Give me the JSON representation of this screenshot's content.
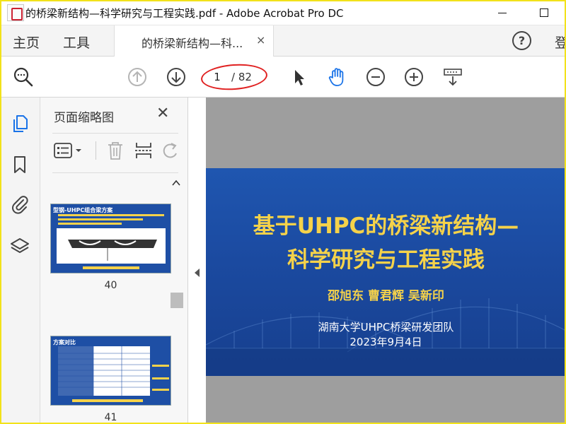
{
  "window": {
    "title": "的桥梁新结构—科学研究与工程实践.pdf - Adobe Acrobat Pro DC"
  },
  "tabs": {
    "home": "主页",
    "tools": "工具",
    "document": "的桥梁新结构—科...",
    "close": "×",
    "help": "?",
    "signin": "登"
  },
  "toolbar": {
    "current_page": "1",
    "total_pages": "/ 82"
  },
  "panel": {
    "title": "页面缩略图",
    "close": "✕",
    "thumbnails": [
      {
        "label": "40",
        "heading": "型钢-UHPC组合梁方案"
      },
      {
        "label": "41",
        "heading": "方案对比"
      }
    ]
  },
  "slide": {
    "title_line1": "基于UHPC的桥梁新结构—",
    "title_line2": "科学研究与工程实践",
    "authors": "邵旭东  曹君辉  吴新印",
    "organization": "湖南大学UHPC桥梁研发团队",
    "date": "2023年9月4日"
  },
  "colors": {
    "accent_blue": "#1a73e8",
    "slide_background": "#1e50a8",
    "slide_title": "#f5d24a",
    "annotation_red": "#e02020"
  }
}
